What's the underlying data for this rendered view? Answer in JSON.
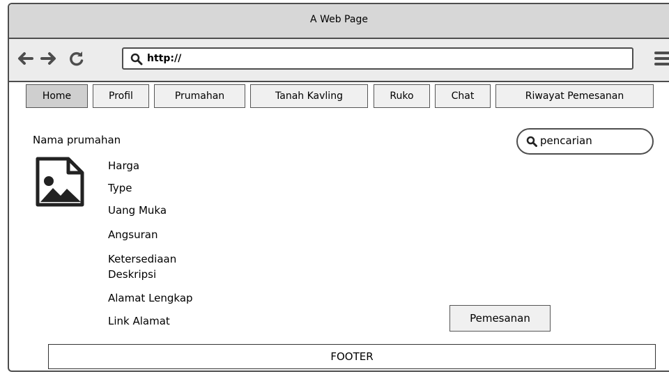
{
  "window": {
    "title": "A Web Page"
  },
  "browser": {
    "url": "http://",
    "back_icon": "arrow-left-icon",
    "forward_icon": "arrow-right-icon",
    "reload_icon": "reload-icon",
    "menu_icon": "hamburger-menu-icon"
  },
  "nav": {
    "tabs": [
      {
        "label": "Home",
        "active": true
      },
      {
        "label": "Profil",
        "active": false
      },
      {
        "label": "Prumahan",
        "active": false
      },
      {
        "label": "Tanah Kavling",
        "active": false
      },
      {
        "label": "Ruko",
        "active": false
      },
      {
        "label": "Chat",
        "active": false
      },
      {
        "label": "Riwayat Pemesanan",
        "active": false
      }
    ]
  },
  "search": {
    "placeholder": "pencarian"
  },
  "listing": {
    "name": "Nama prumahan",
    "image_icon": "image-placeholder-icon",
    "fields": [
      "Harga",
      "Type",
      "Uang Muka",
      "Angsuran",
      "Ketersediaan",
      "Deskripsi",
      "Alamat Lengkap",
      "Link Alamat"
    ]
  },
  "actions": {
    "order_label": "Pemesanan"
  },
  "footer": {
    "text": "FOOTER"
  },
  "colors": {
    "titlebar": "#d7d7d7",
    "navbar": "#ececec",
    "border": "#4d4d4d",
    "active_tab": "#cfcfcf"
  }
}
